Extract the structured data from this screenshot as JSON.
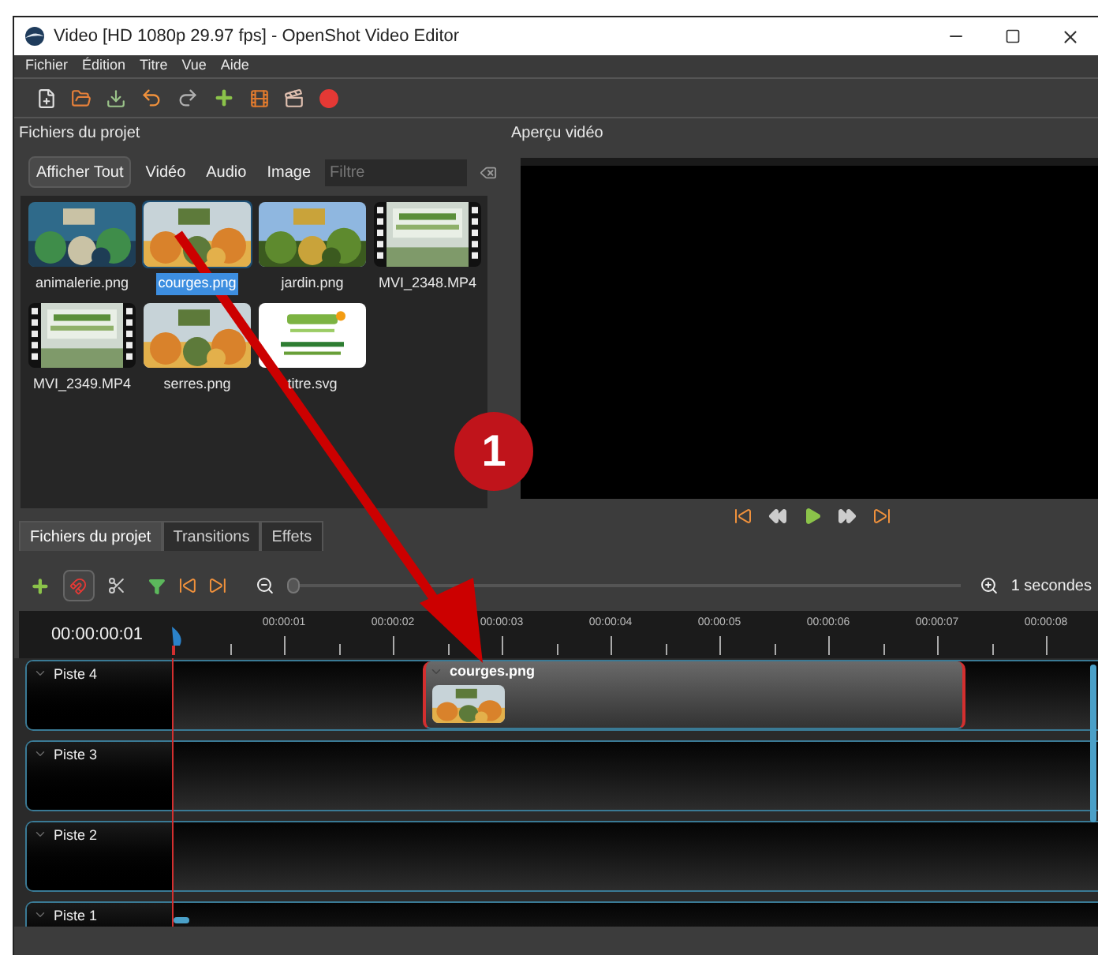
{
  "window": {
    "title": "Video [HD 1080p 29.97 fps] - OpenShot Video Editor"
  },
  "menu": [
    "Fichier",
    "Édition",
    "Titre",
    "Vue",
    "Aide"
  ],
  "project_files": {
    "title": "Fichiers du projet",
    "filters": [
      {
        "label": "Afficher Tout",
        "selected": true
      },
      {
        "label": "Vidéo",
        "selected": false
      },
      {
        "label": "Audio",
        "selected": false
      },
      {
        "label": "Image",
        "selected": false
      }
    ],
    "search": {
      "placeholder": "Filtre"
    },
    "files": [
      {
        "name": "animalerie.png",
        "selected": false
      },
      {
        "name": "courges.png",
        "selected": true
      },
      {
        "name": "jardin.png",
        "selected": false
      },
      {
        "name": "MVI_2348.MP4",
        "kind": "video",
        "selected": false
      },
      {
        "name": "MVI_2349.MP4",
        "kind": "video",
        "selected": false
      },
      {
        "name": "serres.png",
        "selected": false
      },
      {
        "name": "titre.svg",
        "kind": "title",
        "selected": false
      }
    ]
  },
  "preview": {
    "title": "Aperçu vidéo"
  },
  "bottom_tabs": [
    {
      "label": "Fichiers du projet",
      "selected": true
    },
    {
      "label": "Transitions",
      "selected": false
    },
    {
      "label": "Effets",
      "selected": false
    }
  ],
  "timeline": {
    "zoom": {
      "level": 0,
      "label": "1 secondes"
    },
    "timecode": "00:00:00:01",
    "ruler": [
      "00:00:01",
      "00:00:02",
      "00:00:03",
      "00:00:04",
      "00:00:05",
      "00:00:06",
      "00:00:07",
      "00:00:08"
    ],
    "tracks": [
      {
        "name": "Piste 4",
        "clips": [
          {
            "name": "courges.png"
          }
        ]
      },
      {
        "name": "Piste 3"
      },
      {
        "name": "Piste 2"
      },
      {
        "name": "Piste 1"
      }
    ]
  },
  "annotation": {
    "badge": "1"
  }
}
